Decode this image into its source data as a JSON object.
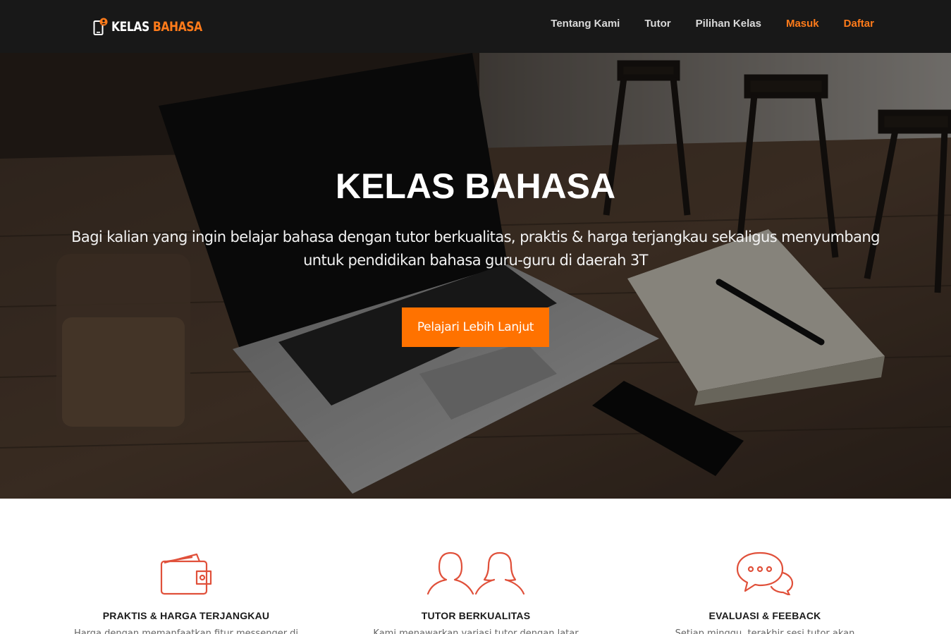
{
  "navbar": {
    "brand": {
      "word1": "KELAS",
      "word2": "BAHASA",
      "icon": "phone-user-logo-icon"
    },
    "links": [
      {
        "label": "Tentang Kami",
        "accent": false
      },
      {
        "label": "Tutor",
        "accent": false
      },
      {
        "label": "Pilihan Kelas",
        "accent": false
      },
      {
        "label": "Masuk",
        "accent": true
      },
      {
        "label": "Daftar",
        "accent": true
      }
    ]
  },
  "hero": {
    "title": "KELAS BAHASA",
    "subtitle_line1": "Bagi kalian yang ingin belajar bahasa dengan tutor berkualitas, praktis & harga terjangkau sekaligus menyumbang",
    "subtitle_line2": "untuk pendidikan bahasa guru-guru di daerah 3T",
    "cta_label": "Pelajari Lebih Lanjut"
  },
  "features": [
    {
      "icon": "wallet-icon",
      "title": "PRAKTIS & HARGA TERJANGKAU",
      "text": "Harga dengan memanfaatkan fitur messenger di"
    },
    {
      "icon": "users-icon",
      "title": "TUTOR BERKUALITAS",
      "text": "Kami menawarkan variasi tutor dengan latar"
    },
    {
      "icon": "chat-bubbles-icon",
      "title": "EVALUASI & FEEBACK",
      "text": "Setiap minggu, terakhir sesi tutor akan"
    }
  ],
  "colors": {
    "accent": "#ff7200",
    "nav_bg": "#181818",
    "icon_stroke": "#e0503a"
  }
}
